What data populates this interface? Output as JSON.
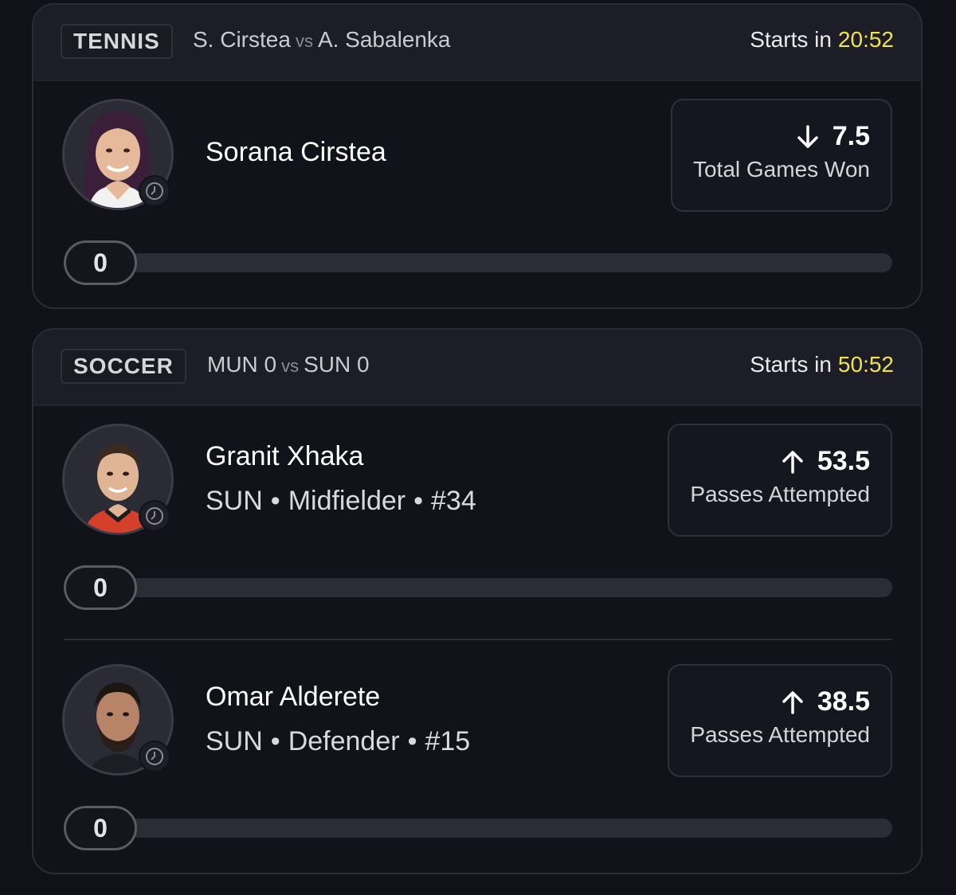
{
  "events": [
    {
      "sport": "TENNIS",
      "match": {
        "home": "S. Cirstea",
        "vs": "vs",
        "away": "A. Sabalenka"
      },
      "starts_label": "Starts in",
      "starts_time": "20:52",
      "players": [
        {
          "name": "Sorana Cirstea",
          "meta": null,
          "direction": "down",
          "line": "7.5",
          "stat": "Total Games Won",
          "progress_value": "0",
          "progress_fraction": 0
        }
      ]
    },
    {
      "sport": "SOCCER",
      "match": {
        "home": "MUN 0",
        "vs": "vs",
        "away": "SUN 0"
      },
      "starts_label": "Starts in",
      "starts_time": "50:52",
      "players": [
        {
          "name": "Granit Xhaka",
          "meta": {
            "team": "SUN",
            "position": "Midfielder",
            "number": "#34",
            "sep": "•"
          },
          "direction": "up",
          "line": "53.5",
          "stat": "Passes Attempted",
          "progress_value": "0",
          "progress_fraction": 0
        },
        {
          "name": "Omar Alderete",
          "meta": {
            "team": "SUN",
            "position": "Defender",
            "number": "#15",
            "sep": "•"
          },
          "direction": "up",
          "line": "38.5",
          "stat": "Passes Attempted",
          "progress_value": "0",
          "progress_fraction": 0
        }
      ]
    }
  ],
  "icons": {
    "clock": "clock-icon",
    "arrow_up": "arrow-up-icon",
    "arrow_down": "arrow-down-icon"
  },
  "colors": {
    "timer": "#f2e34a",
    "background": "#101119",
    "card_header": "#1c1d26"
  }
}
